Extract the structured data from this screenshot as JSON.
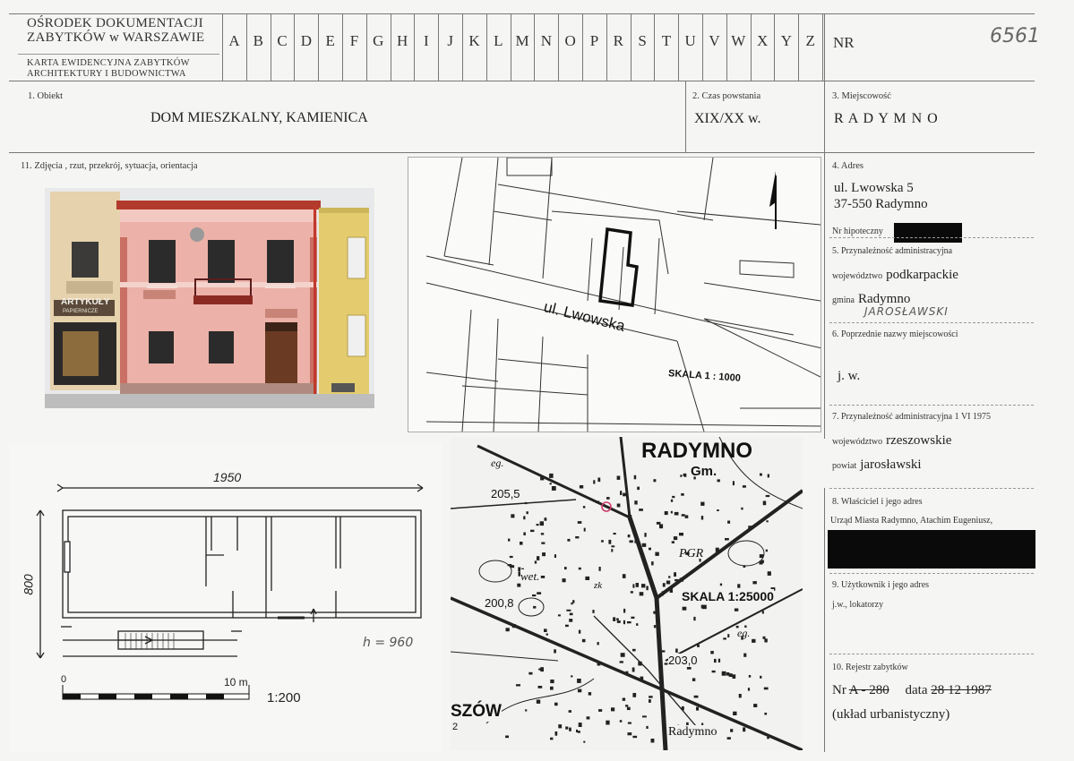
{
  "header": {
    "institution_line1": "OŚRODEK DOKUMENTACJI",
    "institution_line2": "ZABYTKÓW w WARSZAWIE",
    "card_line1": "KARTA EWIDENCYJNA ZABYTKÓW",
    "card_line2": "ARCHITEKTURY I BUDOWNICTWA",
    "letters": [
      "A",
      "B",
      "C",
      "D",
      "E",
      "F",
      "G",
      "H",
      "I",
      "J",
      "K",
      "L",
      "M",
      "N",
      "O",
      "P",
      "R",
      "S",
      "T",
      "U",
      "V",
      "W",
      "X",
      "Y",
      "Z"
    ],
    "nr_label": "NR",
    "nr_value": "6561"
  },
  "field1": {
    "label": "1. Obiekt",
    "value": "DOM MIESZKALNY, KAMIENICA"
  },
  "field2": {
    "label": "2. Czas powstania",
    "value": "XIX/XX w."
  },
  "field3": {
    "label": "3. Miejscowość",
    "value": "R A D Y M N O"
  },
  "field11": {
    "label": "11. Zdjęcia , rzut, przekrój, sytuacja, orientacja"
  },
  "field4": {
    "label": "4. Adres",
    "line1": "ul. Lwowska 5",
    "line2": "37-550 Radymno",
    "hip_label": "Nr hipoteczny"
  },
  "field5": {
    "label": "5. Przynależność administracyjna",
    "woj_label": "województwo",
    "woj_value": "podkarpackie",
    "gmina_label": "gmina",
    "gmina_value": "Radymno",
    "hand_note": "JAROSŁAWSKI"
  },
  "field6": {
    "label": "6. Poprzednie nazwy miejscowości",
    "value": "j. w."
  },
  "field7": {
    "label": "7. Przynależność administracyjna  1 VI  1975",
    "woj_label": "województwo",
    "woj_value": "rzeszowskie",
    "powiat_label": "powiat",
    "powiat_value": "jarosławski"
  },
  "field8": {
    "label": "8. Właściciel i jego adres",
    "value": "Urząd Miasta Radymno, Atachim Eugeniusz,"
  },
  "field9": {
    "label": "9. Użytkownik i jego adres",
    "value": "j.w., lokatorzy"
  },
  "field10": {
    "label": "10. Rejestr zabytków",
    "nr_label": "Nr",
    "nr_value": "A - 280",
    "date_label": "data",
    "date_value": "28 12 1987",
    "note": "(układ urbanistyczny)"
  },
  "photo": {
    "shop_sign": "ARTYKUŁY",
    "shop_sub": "PAPIERNICZE"
  },
  "situation_map": {
    "street": "ul. Lwowska",
    "scale": "SKALA  1 : 1000"
  },
  "floor_plan": {
    "width_dim": "1950",
    "height_dim": "800",
    "h_note": "h = 960",
    "scale_zero": "0",
    "scale_ten": "10 m",
    "scale_ratio": "1:200"
  },
  "topo_map": {
    "town": "RADYMNO",
    "gm": "Gm.",
    "elev1": "205,5",
    "elev2": "200,8",
    "elev3": "203,0",
    "pgr": "PGR",
    "wet": "wet.",
    "eg1": "eg.",
    "eg2": "eg.",
    "zk": "zk",
    "scale": "SKALA 1:25000",
    "szow": "SZÓW",
    "digit": "2",
    "bottom_town": "Radymno"
  },
  "colors": {
    "facade_pink": "#ecb1a8",
    "neighbor_yellow": "#e4cc6e",
    "neighbor_beige": "#e6d2ad",
    "roof_red": "#b23a2c"
  }
}
